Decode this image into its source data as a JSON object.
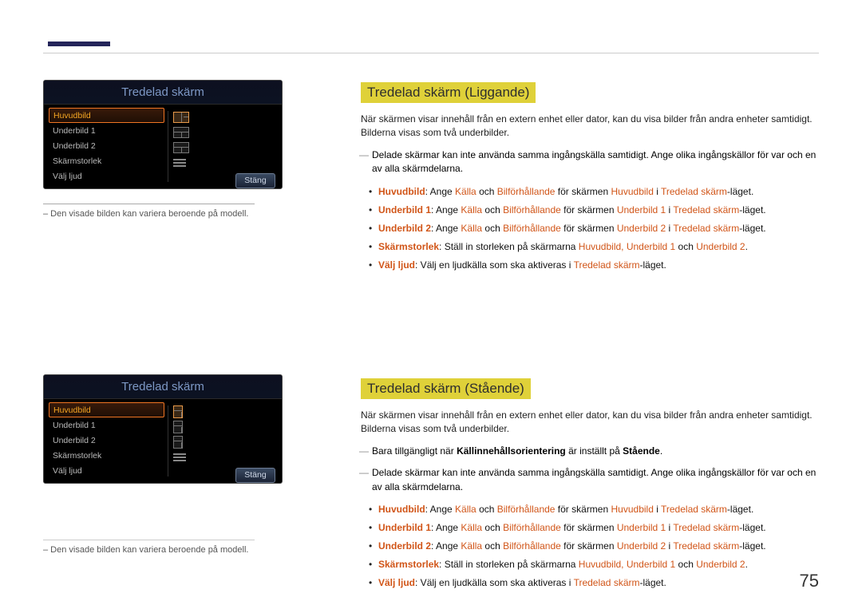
{
  "page_number": "75",
  "panel": {
    "title": "Tredelad skärm",
    "close": "Stäng",
    "items": {
      "huvudbild": "Huvudbild",
      "underbild1": "Underbild 1",
      "underbild2": "Underbild 2",
      "skarmstorlek": "Skärmstorlek",
      "valjljud": "Välj ljud"
    }
  },
  "caption": "– Den visade bilden kan variera beroende på modell.",
  "sec1": {
    "heading": "Tredelad skärm (Liggande)",
    "intro": "När skärmen visar innehåll från en extern enhet eller dator, kan du visa bilder från andra enheter samtidigt. Bilderna visas som två underbilder.",
    "note1": "Delade skärmar kan inte använda samma ingångskälla samtidigt. Ange olika ingångskällor för var och en av alla skärmdelarna.",
    "terms": {
      "huvudbild": "Huvudbild",
      "underbild1": "Underbild 1",
      "underbild2": "Underbild 2",
      "skarmstorlek": "Skärmstorlek",
      "valjljud": "Välj ljud",
      "kalla": "Källa",
      "bildforh": "Bilförhållande",
      "tredelad": "Tredelad skärm",
      "hu_ub1": "Huvudbild, Underbild 1",
      "ub2": "Underbild 2"
    },
    "b1_a": ": Ange ",
    "b1_b": " och ",
    "b1_c": " för skärmen ",
    "b1_d": " i ",
    "b1_e": "-läget.",
    "b4_txt": ": Ställ in storleken på skärmarna ",
    "b4_och": " och ",
    "b5_txt": ": Välj en ljudkälla som ska aktiveras i "
  },
  "sec2": {
    "heading": "Tredelad skärm (Stående)",
    "intro": "När skärmen visar innehåll från en extern enhet eller dator, kan du visa bilder från andra enheter samtidigt. Bilderna visas som två underbilder.",
    "note0a": "Bara tillgängligt när ",
    "note0b": "Källinnehållsorientering",
    "note0c": " är inställt på ",
    "note0d": "Stående",
    "note1": "Delade skärmar kan inte använda samma ingångskälla samtidigt. Ange olika ingångskällor för var och en av alla skärmdelarna."
  }
}
